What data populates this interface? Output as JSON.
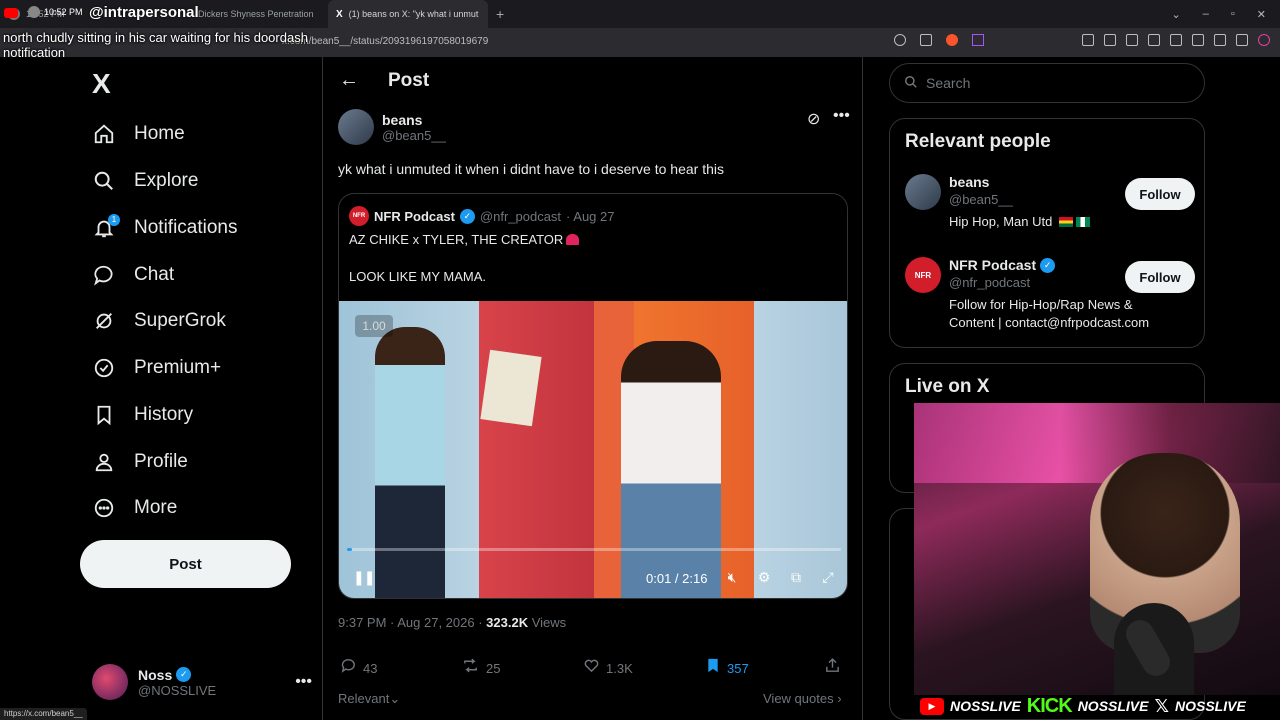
{
  "browser": {
    "tabs": [
      {
        "label": "10:52 PM",
        "active": false
      },
      {
        "label": "Dickers Shyness Penetration",
        "active": false
      },
      {
        "label": "(1) beans on X: \"yk what i unmut",
        "active": true
      }
    ],
    "url": "x.com/bean5__/status/2093196197058019679",
    "status_url": "https://x.com/bean5__"
  },
  "stream_overlay": {
    "clock": "10:52 PM",
    "handle": "@intrapersonal",
    "caption": "north chudly sitting in his car waiting for his doordash notification",
    "banner": [
      "NOSSLIVE",
      "NOSSLIVE",
      "NOSSLIVE"
    ],
    "kick_label": "KICK"
  },
  "nav": {
    "logo": "X",
    "items": [
      {
        "label": "Home",
        "icon": "home-icon"
      },
      {
        "label": "Explore",
        "icon": "search-icon"
      },
      {
        "label": "Notifications",
        "icon": "bell-icon",
        "badge": "1"
      },
      {
        "label": "Chat",
        "icon": "chat-icon"
      },
      {
        "label": "SuperGrok",
        "icon": "grok-icon"
      },
      {
        "label": "Premium+",
        "icon": "verified-icon"
      },
      {
        "label": "History",
        "icon": "bookmark-icon"
      },
      {
        "label": "Profile",
        "icon": "person-icon"
      },
      {
        "label": "More",
        "icon": "more-circle-icon"
      }
    ],
    "post_button": "Post",
    "account": {
      "name": "Noss",
      "handle": "@NOSSLIVE"
    }
  },
  "main": {
    "header_title": "Post",
    "post": {
      "author_name": "beans",
      "author_handle": "@bean5__",
      "text": "yk what i unmuted it when i didnt have to i deserve to hear this",
      "quote": {
        "name": "NFR Podcast",
        "handle": "@nfr_podcast",
        "date": "· Aug 27",
        "line1": "AZ CHIKE x TYLER, THE CREATOR",
        "line2": "LOOK LIKE MY MAMA.",
        "video": {
          "speed": "1.00",
          "time": "0:01 / 2:16",
          "progress": 0.01
        }
      },
      "timestamp": "9:37 PM · Aug 27, 2026 · ",
      "views_count": "323.2K",
      "views_label": " Views",
      "stats": {
        "replies": "43",
        "reposts": "25",
        "likes": "1.3K",
        "bookmarks": "357"
      },
      "sort_label": "Relevant",
      "view_quotes": "View quotes"
    }
  },
  "search": {
    "placeholder": "Search"
  },
  "relevant_people": {
    "title": "Relevant people",
    "people": [
      {
        "name": "beans",
        "handle": "@bean5__",
        "bio": "Hip Hop, Man Utd",
        "follow": "Follow",
        "verified": false
      },
      {
        "name": "NFR Podcast",
        "handle": "@nfr_podcast",
        "bio": "Follow for Hip-Hop/Rap News & Content | contact@nfrpodcast.com",
        "follow": "Follow",
        "verified": true
      }
    ]
  },
  "live": {
    "title": "Live on X"
  },
  "colors": {
    "accent": "#1d9bf0",
    "background": "#000000",
    "border": "#2f3336",
    "muted": "#71767b",
    "kick": "#53fc18"
  }
}
